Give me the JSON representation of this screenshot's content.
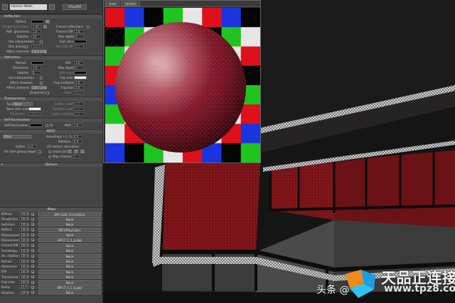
{
  "editor": {
    "material_name": "Interior Walls",
    "material_type": "VRayMtl"
  },
  "reflection": {
    "header": "Reflection",
    "reflect_label": "Reflect",
    "reflect_value": "M",
    "hilight_label": "Hilight glossiness",
    "hilight_value": "1.00",
    "hilight_lock": "L",
    "fresnel_label": "Fresnel reflections",
    "refl_gloss_label": "Refl. glossiness",
    "refl_gloss_value": "1.0",
    "fresnel_ior_label": "Fresnel IOR",
    "fresnel_ior_value": "1.6",
    "subdivs_label": "Subdivs",
    "subdivs_value": "16",
    "max_depth_label": "Max depth",
    "max_depth_value": "5",
    "use_interp_label": "Use interpolation",
    "exit_color_label": "Exit color",
    "dim_distance_label": "Dim distance",
    "dim_distance_value": "100.0",
    "dim_falloff_label": "Dim fall off",
    "dim_falloff_value": "0.0",
    "affect_channels_label": "Affect channels",
    "affect_channels_value": "Color only"
  },
  "refraction": {
    "header": "Refraction",
    "refract_label": "Refract",
    "ior_label": "IOR",
    "ior_value": "1.6",
    "glossiness_label": "Glossiness",
    "glossiness_value": "1.0",
    "max_depth_label": "Max depth",
    "max_depth_value": "5",
    "subdivs_label": "Subdivs",
    "subdivs_value": "8",
    "exit_color_label": "Exit color",
    "use_interp_label": "Use interpolation",
    "fog_color_label": "Fog color",
    "affect_shadows_label": "Affect shadows",
    "fog_multiplier_label": "Fog multiplier",
    "fog_multiplier_value": "1.0",
    "affect_channels_label": "Affect channels",
    "affect_channels_value": "Color only",
    "fog_bias_label": "Fog bias",
    "fog_bias_value": "0.0",
    "dispersion_label": "Dispersion",
    "abbe_label": "Abbe",
    "abbe_value": "50.0"
  },
  "translucency": {
    "header": "Translucency",
    "type_label": "Type",
    "type_value": "None",
    "scatter_label": "Scatter coeff",
    "scatter_value": "0.0",
    "backside_label": "Back-side color",
    "fwd_bck_label": "Fwd/bck coeff",
    "fwd_bck_value": "1.0",
    "thickness_label": "Thickness",
    "thickness_value": "1000.0",
    "light_mult_label": "Light multiplier",
    "light_mult_value": "1.0"
  },
  "self_illum": {
    "header": "Self-illumination",
    "label": "Self-illumination",
    "gi_label": "GI",
    "mult_label": "Mult",
    "mult_value": "1.0"
  },
  "brdf": {
    "header": "BRDF",
    "type_value": "Blinn",
    "anisotropy_label": "Anisotropy (-1..1)",
    "anisotropy_value": "0.0",
    "rotation_label": "Rotation",
    "rotation_value": "0.0",
    "soften_label": "Soften",
    "soften_value": "0.0",
    "uv_label": "UV vectors derivation",
    "fix_dark_label": "Fix dark glossy edges",
    "local_axis_label": "Local axis",
    "x": "X",
    "y": "Y",
    "z": "Z",
    "map_channel_label": "Map channel",
    "map_channel_value": "1"
  },
  "options": {
    "header": "Options"
  },
  "maps": {
    "header": "Maps",
    "rows": [
      {
        "name": "Diffuse",
        "amount": "100.0",
        "map": "DM (Color Correction)"
      },
      {
        "name": "Roughness",
        "amount": "100.0",
        "map": "None"
      },
      {
        "name": "Self-illum",
        "amount": "100.0",
        "map": "None"
      },
      {
        "name": "Reflect",
        "amount": "100.0",
        "map": "RM (VRayColor)"
      },
      {
        "name": "HGlossiness",
        "amount": "100.0",
        "map": "None"
      },
      {
        "name": "RGlossiness",
        "amount": "100.0",
        "map": "GM (7_1_1_g.jpg)"
      },
      {
        "name": "Fresnel IOR",
        "amount": "100.0",
        "map": "None"
      },
      {
        "name": "Anisotropy",
        "amount": "100.0",
        "map": "None"
      },
      {
        "name": "An. rotation",
        "amount": "100.0",
        "map": "None"
      },
      {
        "name": "Refract",
        "amount": "100.0",
        "map": "None"
      },
      {
        "name": "Glossiness",
        "amount": "100.0",
        "map": "None"
      },
      {
        "name": "IOR",
        "amount": "100.0",
        "map": "None"
      },
      {
        "name": "Translucent",
        "amount": "100.0",
        "map": "None"
      },
      {
        "name": "Fog color",
        "amount": "100.0",
        "map": "None"
      },
      {
        "name": "Bump",
        "amount": "25.0",
        "map": "BM (7_1_1_b.jpg)"
      },
      {
        "name": "Displace",
        "amount": "100.0",
        "map": "None"
      }
    ]
  },
  "preview": {
    "tab_auto": "Auto",
    "tab_update": "Update"
  },
  "watermark": {
    "left_text": "头条 @",
    "brand": "天品正连接",
    "url": "www.tpz8.com"
  },
  "colors": {
    "sphere": "#8e1b2b",
    "checker_red": "#e0101a",
    "checker_green": "#1fc41f",
    "checker_blue": "#1a35e0",
    "checker_white": "#e6e6e6",
    "checker_black": "#050505",
    "wall_red": "#7a1418"
  }
}
